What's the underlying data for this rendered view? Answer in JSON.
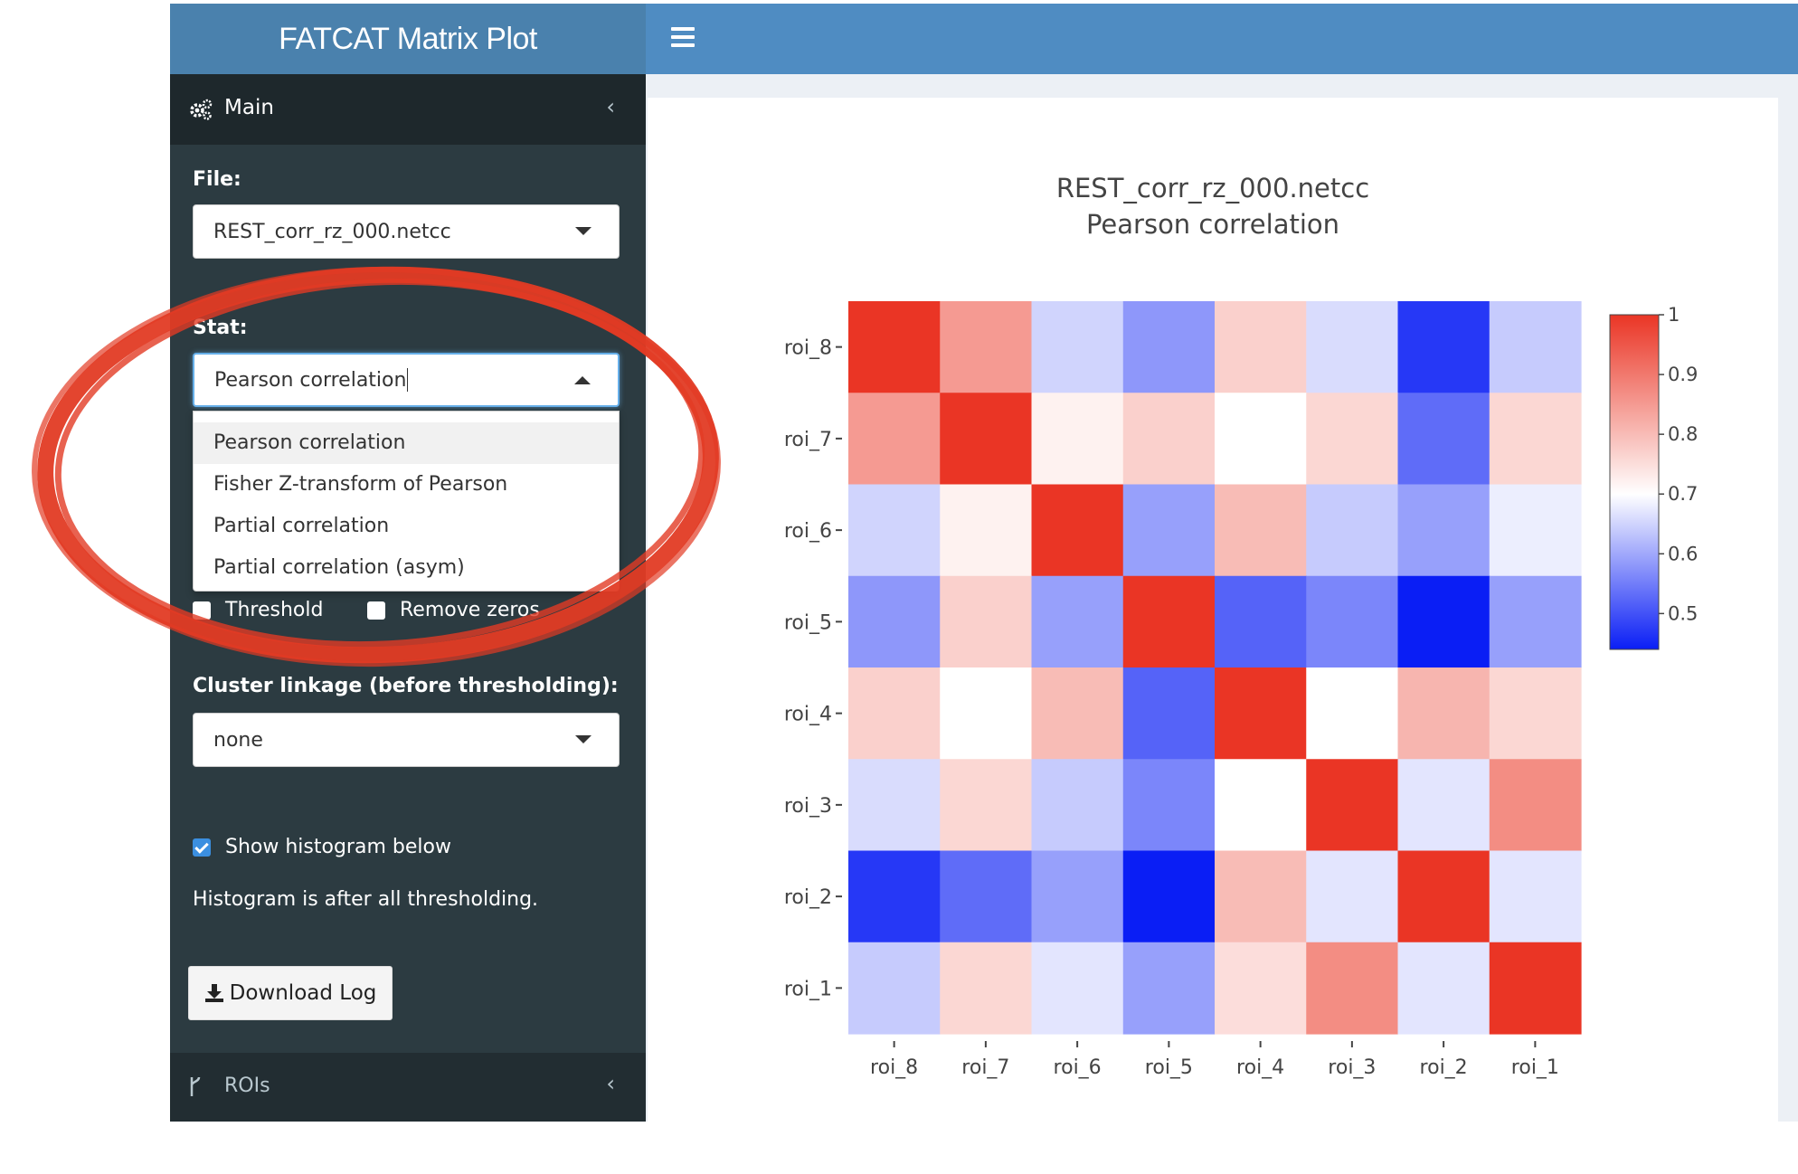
{
  "header": {
    "title": "FATCAT Matrix Plot"
  },
  "sidebar": {
    "main_label": "Main",
    "file_label": "File:",
    "file_value": "REST_corr_rz_000.netcc",
    "stat_label": "Stat:",
    "stat_value": "Pearson correlation",
    "stat_options": [
      "Pearson correlation",
      "Fisher Z-transform of Pearson",
      "Partial correlation",
      "Partial correlation (asym)"
    ],
    "threshold_label": "Threshold",
    "remove_zeros_label": "Remove zeros",
    "cluster_label": "Cluster linkage (before thresholding):",
    "cluster_value": "none",
    "show_histogram_label": "Show histogram below",
    "histogram_note": "Histogram is after all thresholding.",
    "download_label": "Download Log",
    "rois_label": "ROIs"
  },
  "chart_data": {
    "type": "heatmap",
    "title": "REST_corr_rz_000.netcc",
    "subtitle": "Pearson correlation",
    "x_labels": [
      "roi_8",
      "roi_7",
      "roi_6",
      "roi_5",
      "roi_4",
      "roi_3",
      "roi_2",
      "roi_1"
    ],
    "y_labels": [
      "roi_8",
      "roi_7",
      "roi_6",
      "roi_5",
      "roi_4",
      "roi_3",
      "roi_2",
      "roi_1"
    ],
    "values": [
      [
        1.0,
        0.85,
        0.65,
        0.58,
        0.77,
        0.66,
        0.47,
        0.64
      ],
      [
        0.85,
        1.0,
        0.72,
        0.77,
        0.7,
        0.76,
        0.53,
        0.76
      ],
      [
        0.65,
        0.72,
        1.0,
        0.59,
        0.8,
        0.64,
        0.59,
        0.68
      ],
      [
        0.58,
        0.77,
        0.59,
        1.0,
        0.52,
        0.56,
        0.44,
        0.59
      ],
      [
        0.77,
        0.7,
        0.8,
        0.52,
        1.0,
        0.7,
        0.81,
        0.76
      ],
      [
        0.66,
        0.76,
        0.64,
        0.56,
        0.7,
        1.0,
        0.67,
        0.87
      ],
      [
        0.47,
        0.53,
        0.59,
        0.44,
        0.8,
        0.67,
        1.0,
        0.67
      ],
      [
        0.64,
        0.76,
        0.67,
        0.59,
        0.75,
        0.87,
        0.67,
        1.0
      ]
    ],
    "colorscale": {
      "min": 0.44,
      "max": 1.0,
      "mid": 0.7,
      "low_color": "#0a1ef5",
      "mid_color": "#ffffff",
      "high_color": "#ea3525"
    },
    "colorbar_ticks": [
      "1",
      "0.9",
      "0.8",
      "0.7",
      "0.6",
      "0.5"
    ],
    "colorbar_tick_values": [
      1,
      0.9,
      0.8,
      0.7,
      0.6,
      0.5
    ]
  }
}
